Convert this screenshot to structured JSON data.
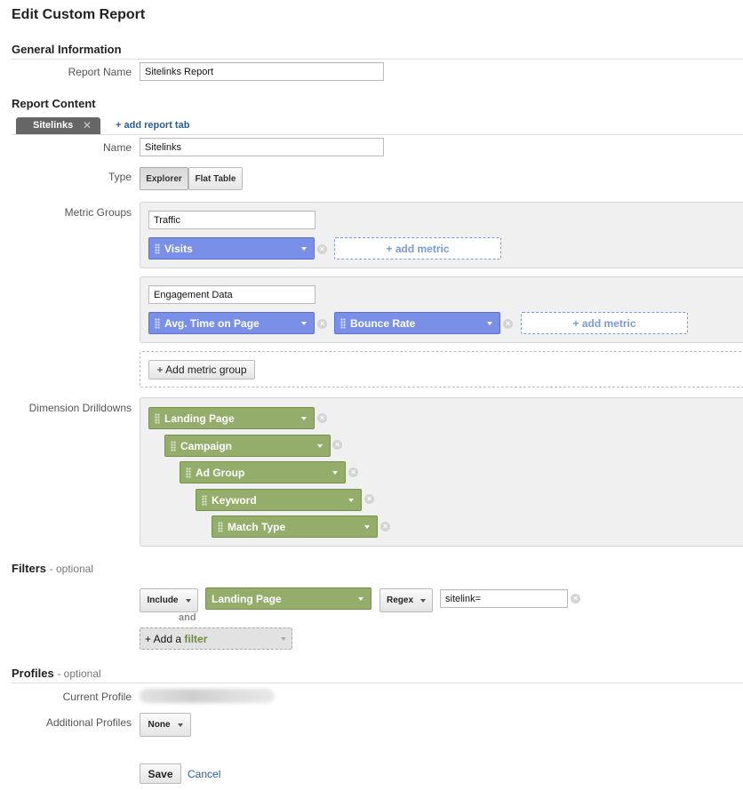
{
  "page": {
    "title": "Edit Custom Report"
  },
  "general": {
    "heading": "General Information",
    "report_name_label": "Report Name",
    "report_name_value": "Sitelinks Report"
  },
  "content": {
    "heading": "Report Content",
    "active_tab": "Sitelinks",
    "add_tab": "+ add report tab",
    "name_label": "Name",
    "name_value": "Sitelinks",
    "type_label": "Type",
    "type_options": [
      "Explorer",
      "Flat Table"
    ],
    "metric_groups_label": "Metric Groups",
    "metric_groups": [
      {
        "name": "Traffic",
        "metrics": [
          "Visits"
        ]
      },
      {
        "name": "Engagement Data",
        "metrics": [
          "Avg. Time on Page",
          "Bounce Rate"
        ]
      }
    ],
    "add_metric": "+ add metric",
    "add_metric_group": "+ Add metric group",
    "dimension_label": "Dimension Drilldowns",
    "dimensions": [
      "Landing Page",
      "Campaign",
      "Ad Group",
      "Keyword",
      "Match Type"
    ]
  },
  "filters": {
    "heading": "Filters",
    "optional": "- optional",
    "include": "Include",
    "dimension": "Landing Page",
    "match": "Regex",
    "value": "sitelink=",
    "and": "and",
    "add_prefix": "+ Add a",
    "add_word": "filter"
  },
  "profiles": {
    "heading": "Profiles",
    "optional": "- optional",
    "current_label": "Current Profile",
    "additional_label": "Additional Profiles",
    "additional_value": "None"
  },
  "actions": {
    "save": "Save",
    "cancel": "Cancel"
  },
  "colors": {
    "metric_chip": "#7a8fe8",
    "dimension_chip": "#94ad6b",
    "link": "#2b5d9c"
  }
}
